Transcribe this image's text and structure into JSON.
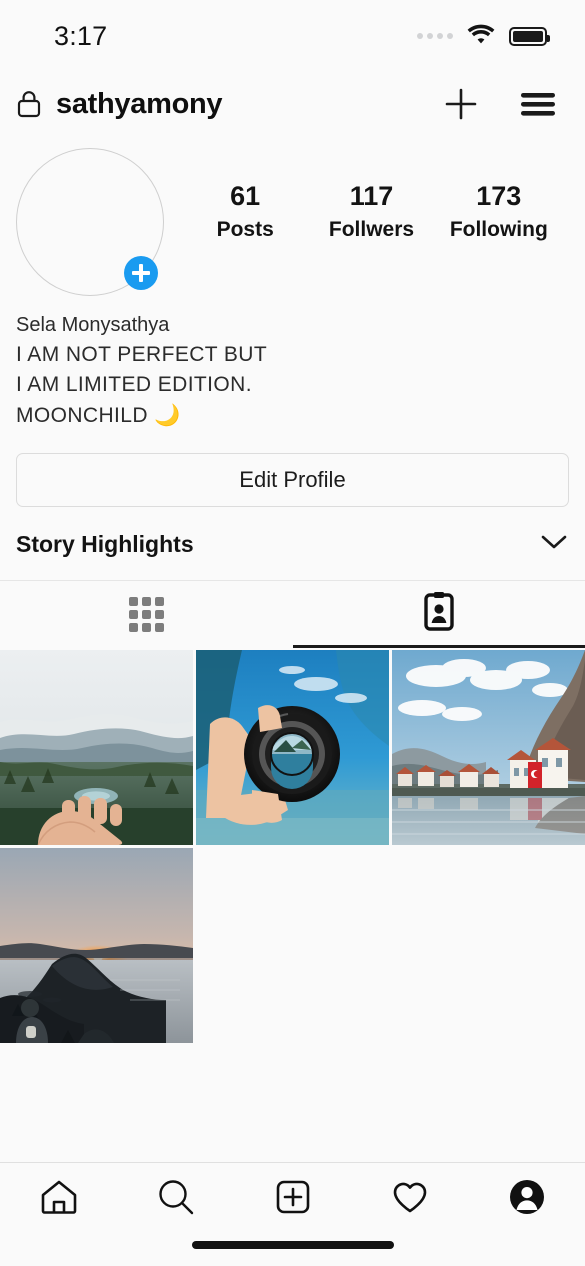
{
  "statusbar": {
    "time": "3:17",
    "signal_icon": "signal-dots-icon",
    "wifi_icon": "wifi-icon",
    "battery_icon": "battery-full-icon"
  },
  "header": {
    "lock_icon": "lock-icon",
    "username": "sathyamony",
    "add_icon": "plus-icon",
    "menu_icon": "hamburger-menu-icon"
  },
  "profile": {
    "avatar": {
      "badge_icon": "add-story-plus-icon",
      "badge_color": "#1a9bf0"
    },
    "stats": [
      {
        "value": "61",
        "label": "Posts"
      },
      {
        "value": "117",
        "label": "Follwers"
      },
      {
        "value": "173",
        "label": "Following"
      }
    ],
    "display_name": "Sela Monysathya",
    "bio_lines": [
      "I AM NOT PERFECT BUT",
      "I AM LIMITED EDITION.",
      "MOONCHILD 🌙"
    ],
    "edit_button": "Edit Profile"
  },
  "highlights": {
    "title": "Story Highlights",
    "chevron_icon": "chevron-down-icon"
  },
  "tabs": [
    {
      "name": "grid",
      "icon": "grid-icon",
      "active": false
    },
    {
      "name": "tagged",
      "icon": "tagged-person-card-icon",
      "active": true
    }
  ],
  "photos": [
    {
      "id": "photo-forest-hand",
      "alt": "Hazy mountain forest with lake and open palm"
    },
    {
      "id": "photo-camera-lens",
      "alt": "Hand holding camera lens over blue lake"
    },
    {
      "id": "photo-riverside-town",
      "alt": "Cliffside town reflected in river with red flag"
    },
    {
      "id": "photo-lake-sunset",
      "alt": "Sunset over lake with island silhouette"
    }
  ],
  "bottomnav": {
    "items": [
      {
        "name": "home",
        "icon": "home-icon"
      },
      {
        "name": "search",
        "icon": "search-icon"
      },
      {
        "name": "create",
        "icon": "add-square-icon"
      },
      {
        "name": "activity",
        "icon": "heart-icon"
      },
      {
        "name": "profile",
        "icon": "profile-avatar-icon"
      }
    ]
  },
  "colors": {
    "background": "#fafafa",
    "text": "#131313",
    "accent_blue": "#1a9bf0",
    "border": "#e0e0e0"
  }
}
